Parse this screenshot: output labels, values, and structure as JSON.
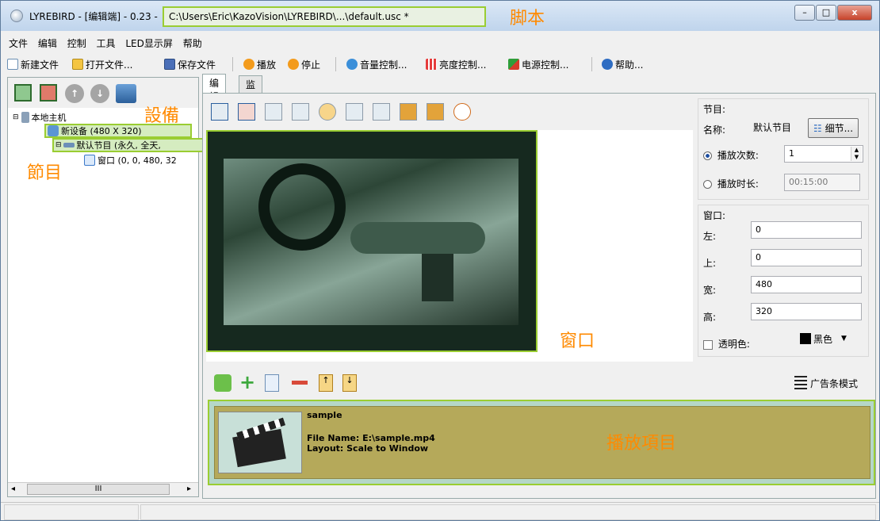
{
  "window": {
    "title": "LYREBIRD - [编辑端] - 0.23 -",
    "path": "C:\\Users\\Eric\\KazoVision\\LYREBIRD\\...\\default.usc *",
    "minimize": "–",
    "maximize": "□",
    "close": "x"
  },
  "annotations": {
    "script": "脚本",
    "device": "設備",
    "program": "節目",
    "window": "窗口",
    "play_items": "播放項目"
  },
  "menu": [
    "文件",
    "编辑",
    "控制",
    "工具",
    "LED显示屏",
    "帮助"
  ],
  "toolbar": {
    "new_file": "新建文件",
    "open_file": "打开文件...",
    "save_file": "保存文件",
    "play": "播放",
    "stop": "停止",
    "volume": "音量控制...",
    "brightness": "亮度控制...",
    "power": "电源控制...",
    "help": "帮助..."
  },
  "tree": {
    "host": "本地主机",
    "device": "新设备 (480 X 320)",
    "program": "默认节目 (永久, 全天,",
    "window": "窗口 (0, 0, 480, 32"
  },
  "scroll": {
    "left": "◂",
    "grip": "III",
    "right": "▸"
  },
  "tabs": [
    "编辑",
    "监控"
  ],
  "program": {
    "group_label": "节目:",
    "name_label": "名称:",
    "name_value": "默认节目",
    "details_button": "细节...",
    "play_count_label": "播放次数:",
    "play_count_value": "1",
    "play_duration_label": "播放时长:",
    "play_duration_value": "00:15:00"
  },
  "window_props": {
    "group_label": "窗口:",
    "left_label": "左:",
    "left_value": "0",
    "top_label": "上:",
    "top_value": "0",
    "width_label": "宽:",
    "width_value": "480",
    "height_label": "高:",
    "height_value": "320",
    "transparent_label": "透明色:",
    "color_value": "黑色"
  },
  "ad_mode": "广告条模式",
  "play_item": {
    "name": "sample",
    "file": "File Name: E:\\sample.mp4",
    "layout": "Layout: Scale to Window"
  },
  "colors": {
    "highlight": "#9acd32",
    "annotation": "#ff8a00",
    "item_bg": "#b5a95a"
  }
}
